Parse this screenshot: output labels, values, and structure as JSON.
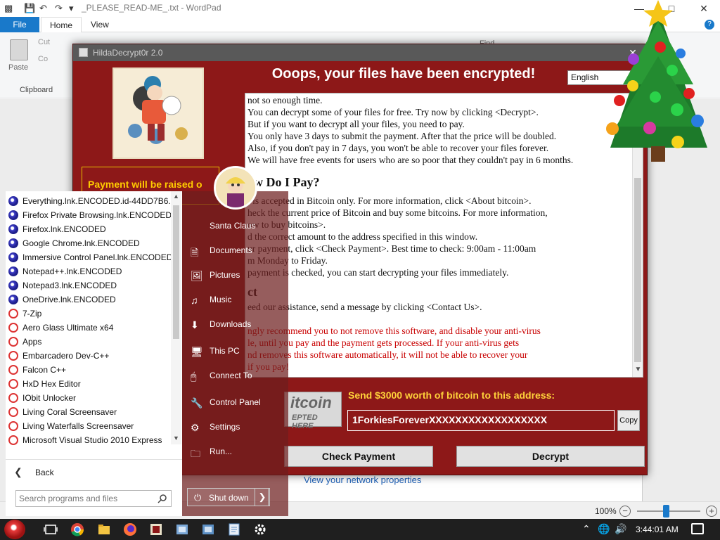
{
  "wordpad": {
    "title": "_PLEASE_READ-ME_.txt - WordPad",
    "tabs": [
      "File",
      "Home",
      "View"
    ],
    "ribbon": {
      "paste_label": "Paste",
      "cut_label": "Cut",
      "copy_label": "Co",
      "clipboard_group": "Clipboard",
      "find_label": "Find"
    },
    "document_link": "View your network properties",
    "zoom": "100%",
    "zoom_fraction": 0.45
  },
  "hilda": {
    "title": "HildaDecrypt0r 2.0",
    "heading": "Ooops, your files have been encrypted!",
    "language": "English",
    "payment_raised": "Payment will be raised o",
    "message_lines": [
      {
        "text": "not so enough time.",
        "style": "normal"
      },
      {
        "text": "You can decrypt some of your files for free. Try now by clicking <Decrypt>.",
        "style": "normal"
      },
      {
        "text": "But if you want to decrypt all your files, you need to pay.",
        "style": "normal"
      },
      {
        "text": "You only have 3 days to submit the payment. After that the price will be doubled.",
        "style": "normal"
      },
      {
        "text": "Also, if you don't pay in 7 days, you won't be able to recover your files forever.",
        "style": "normal"
      },
      {
        "text": "We will have free events for users who are so poor that they couldn't pay in 6 months.",
        "style": "normal"
      },
      {
        "text": "ow Do I Pay?",
        "style": "heading"
      },
      {
        "text": "t is accepted in Bitcoin only. For more information, click <About bitcoin>.",
        "style": "normal"
      },
      {
        "text": "heck the current price of Bitcoin and buy some bitcoins. For more information,",
        "style": "normal"
      },
      {
        "text": "ow to buy bitcoins>.",
        "style": "normal"
      },
      {
        "text": "d the correct amount to the address specified in this window.",
        "style": "normal"
      },
      {
        "text": "ur payment, click <Check Payment>. Best time to check: 9:00am - 11:00am",
        "style": "normal"
      },
      {
        "text": "m Monday to Friday.",
        "style": "normal"
      },
      {
        "text": "payment is checked, you can start decrypting your files immediately.",
        "style": "normal"
      },
      {
        "text": "ct",
        "style": "heading"
      },
      {
        "text": "eed our assistance, send a message by clicking <Contact Us>.",
        "style": "normal"
      },
      {
        "text": "ngly recommend you to not remove this software, and disable your anti-virus",
        "style": "warn"
      },
      {
        "text": "le, until you pay and the payment gets processed. If your anti-virus gets",
        "style": "warn"
      },
      {
        "text": "nd removes this software automatically, it will not be able to recover your",
        "style": "warn"
      },
      {
        "text": "if you pay!",
        "style": "warn"
      }
    ],
    "bitcoin_logo_word": "itcoin",
    "bitcoin_logo_sub": "EPTED HERE",
    "send_label": "Send $3000 worth of bitcoin to this address:",
    "address": "1ForkiesForeverXXXXXXXXXXXXXXXXXX",
    "copy_label": "Copy",
    "check_payment_label": "Check Payment",
    "decrypt_label": "Decrypt"
  },
  "start_menu": {
    "programs": [
      {
        "label": "Everything.lnk.ENCODED.id-44DD7B6...",
        "icon": "encrypted-file-icon"
      },
      {
        "label": "Firefox Private Browsing.lnk.ENCODED",
        "icon": "encrypted-file-icon"
      },
      {
        "label": "Firefox.lnk.ENCODED",
        "icon": "encrypted-file-icon"
      },
      {
        "label": "Google Chrome.lnk.ENCODED",
        "icon": "encrypted-file-icon"
      },
      {
        "label": "Immersive Control Panel.lnk.ENCODED",
        "icon": "encrypted-file-icon"
      },
      {
        "label": "Notepad++.lnk.ENCODED",
        "icon": "encrypted-file-icon"
      },
      {
        "label": "Notepad3.lnk.ENCODED",
        "icon": "encrypted-file-icon"
      },
      {
        "label": "OneDrive.lnk.ENCODED",
        "icon": "encrypted-file-icon"
      },
      {
        "label": "7-Zip",
        "icon": "folder-icon"
      },
      {
        "label": "Aero Glass Ultimate x64",
        "icon": "folder-icon"
      },
      {
        "label": "Apps",
        "icon": "folder-icon"
      },
      {
        "label": "Embarcadero Dev-C++",
        "icon": "folder-icon"
      },
      {
        "label": "Falcon C++",
        "icon": "folder-icon"
      },
      {
        "label": "HxD Hex Editor",
        "icon": "folder-icon"
      },
      {
        "label": "IObit Unlocker",
        "icon": "folder-icon"
      },
      {
        "label": "Living Coral Screensaver",
        "icon": "folder-icon"
      },
      {
        "label": "Living Waterfalls Screensaver",
        "icon": "folder-icon"
      },
      {
        "label": "Microsoft Visual Studio 2010 Express",
        "icon": "folder-icon"
      }
    ],
    "back_label": "Back",
    "search_placeholder": "Search programs and files",
    "places": [
      {
        "label": "Santa Claus",
        "icon": "user-icon"
      },
      {
        "label": "Documents",
        "icon": "documents-icon"
      },
      {
        "label": "Pictures",
        "icon": "pictures-icon"
      },
      {
        "label": "Music",
        "icon": "music-icon"
      },
      {
        "label": "Downloads",
        "icon": "downloads-icon"
      },
      {
        "label": "This PC",
        "icon": "computer-icon"
      },
      {
        "label": "Connect To",
        "icon": "network-icon"
      },
      {
        "label": "Control Panel",
        "icon": "control-panel-icon"
      },
      {
        "label": "Settings",
        "icon": "gear-icon"
      },
      {
        "label": "Run...",
        "icon": "run-icon"
      }
    ],
    "shutdown_label": "Shut down"
  },
  "taskbar": {
    "clock": "3:44:01 AM",
    "pinned": [
      "task-view-icon",
      "chrome-icon",
      "file-explorer-icon",
      "firefox-icon",
      "hilda-decryptor-icon",
      "app-icon",
      "app-icon",
      "wordpad-icon",
      "settings-icon"
    ]
  },
  "colors": {
    "ransom_red": "#8d1818",
    "send_yellow": "#ffd23a",
    "warning_text": "#c80000",
    "wordpad_blue": "#1979ca"
  }
}
